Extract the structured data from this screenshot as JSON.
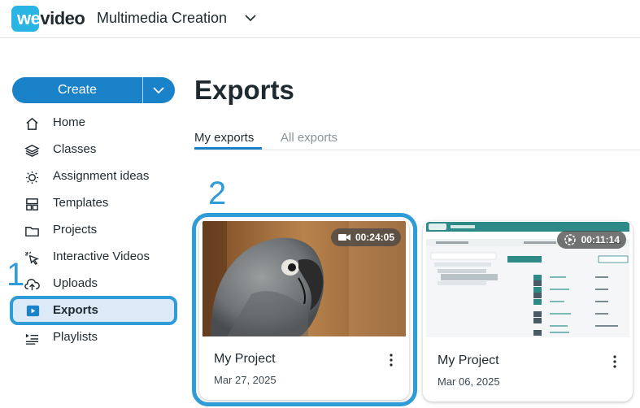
{
  "header": {
    "logo_we": "we",
    "logo_video": "video",
    "workspace": "Multimedia Creation"
  },
  "sidebar": {
    "create_label": "Create",
    "items": [
      {
        "label": "Home",
        "icon": "home-icon"
      },
      {
        "label": "Classes",
        "icon": "layers-icon"
      },
      {
        "label": "Assignment ideas",
        "icon": "lightbulb-icon"
      },
      {
        "label": "Templates",
        "icon": "templates-icon"
      },
      {
        "label": "Projects",
        "icon": "folder-icon"
      },
      {
        "label": "Interactive Videos",
        "icon": "cursor-click-icon"
      },
      {
        "label": "Uploads",
        "icon": "cloud-upload-icon"
      },
      {
        "label": "Exports",
        "icon": "play-square-icon",
        "active": true
      },
      {
        "label": "Playlists",
        "icon": "playlist-icon"
      }
    ]
  },
  "annotations": {
    "step1": "1",
    "step2": "2"
  },
  "main": {
    "title": "Exports",
    "tabs": [
      {
        "label": "My exports",
        "active": true
      },
      {
        "label": "All exports",
        "active": false
      }
    ],
    "exports": [
      {
        "title": "My Project",
        "date": "Mar 27, 2025",
        "duration": "00:24:05",
        "duration_icon": "video-camera-icon",
        "thumbnail": "parrot-photo"
      },
      {
        "title": "My Project",
        "date": "Mar 06, 2025",
        "duration": "00:11:14",
        "duration_icon": "interactive-play-icon",
        "thumbnail": "app-screenshot"
      }
    ]
  },
  "colors": {
    "brand": "#2ab4e4",
    "primary": "#1a82c9",
    "annotation": "#2f9bd7",
    "active_bg": "#dce9f6"
  }
}
